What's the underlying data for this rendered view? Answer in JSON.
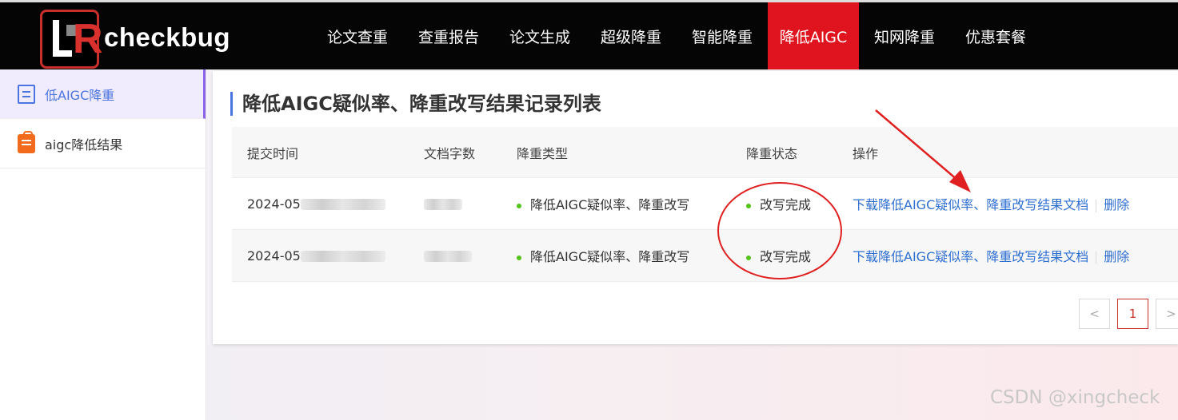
{
  "brand": {
    "name": "checkbug",
    "logo_letters": "R"
  },
  "nav": {
    "items": [
      {
        "label": "论文查重"
      },
      {
        "label": "查重报告"
      },
      {
        "label": "论文生成"
      },
      {
        "label": "超级降重"
      },
      {
        "label": "智能降重"
      },
      {
        "label": "降低AIGC",
        "active": true
      },
      {
        "label": "知网降重"
      },
      {
        "label": "优惠套餐"
      }
    ],
    "active_color": "#e0141e"
  },
  "sidebar": {
    "items": [
      {
        "label": "低AIGC降重",
        "icon": "document-icon",
        "active": true
      },
      {
        "label": "aigc降低结果",
        "icon": "clipboard-icon"
      }
    ]
  },
  "main": {
    "title": "降低AIGC疑似率、降重改写结果记录列表",
    "table": {
      "headers": [
        "提交时间",
        "文档字数",
        "降重类型",
        "降重状态",
        "操作"
      ],
      "rows": [
        {
          "time_visible": "2024-05",
          "type": "降低AIGC疑似率、降重改写",
          "status": "改写完成",
          "download_label": "下载降低AIGC疑似率、降重改写结果文档",
          "delete_label": "删除"
        },
        {
          "time_visible": "2024-05",
          "type": "降低AIGC疑似率、降重改写",
          "status": "改写完成",
          "download_label": "下载降低AIGC疑似率、降重改写结果文档",
          "delete_label": "删除"
        }
      ]
    },
    "pagination": {
      "prev": "<",
      "current": "1",
      "next": ">"
    }
  },
  "annotations": {
    "color": "#e02020"
  },
  "watermark": "CSDN @xingcheck"
}
